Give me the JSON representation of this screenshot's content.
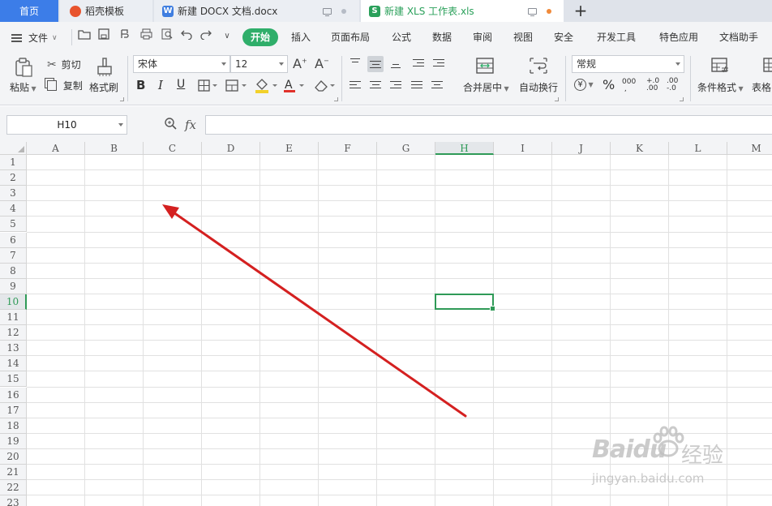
{
  "tabs": {
    "home": "首页",
    "template": "稻壳模板",
    "doc": "新建 DOCX 文档.docx",
    "xls": "新建 XLS 工作表.xls",
    "doc_icon": "W",
    "xls_icon": "S"
  },
  "menu": {
    "file": "文件",
    "items": [
      "开始",
      "插入",
      "页面布局",
      "公式",
      "数据",
      "审阅",
      "视图",
      "安全",
      "开发工具",
      "特色应用",
      "文档助手"
    ]
  },
  "ribbon": {
    "paste": "粘贴",
    "cut": "剪切",
    "copy": "复制",
    "format_painter": "格式刷",
    "font_name": "宋体",
    "font_size": "12",
    "merge_center": "合并居中",
    "wrap_text": "自动换行",
    "number_format": "常规",
    "conditional_format": "条件格式",
    "table_style": "表格",
    "currency_symbol": "¥",
    "percent_symbol": "%"
  },
  "formula_bar": {
    "name_box": "H10",
    "fx": "fx",
    "value": ""
  },
  "grid": {
    "columns": [
      "A",
      "B",
      "C",
      "D",
      "E",
      "F",
      "G",
      "H",
      "I",
      "J",
      "K",
      "L",
      "M"
    ],
    "rows": [
      "1",
      "2",
      "3",
      "4",
      "5",
      "6",
      "7",
      "8",
      "9",
      "10",
      "11",
      "12",
      "13",
      "14",
      "15",
      "16",
      "17",
      "18",
      "19",
      "20",
      "21",
      "22",
      "23"
    ],
    "active_cell": "H10",
    "active_column": "H",
    "active_row": "10"
  },
  "annotation": {
    "arrow_color": "#d42020"
  },
  "watermark": {
    "brand": "Baidu",
    "cn": "经验",
    "url": "jingyan.baidu.com"
  },
  "colors": {
    "accent_green": "#2fae6a",
    "home_tab_blue": "#3c7de8",
    "selection_green": "#2f9a57"
  }
}
